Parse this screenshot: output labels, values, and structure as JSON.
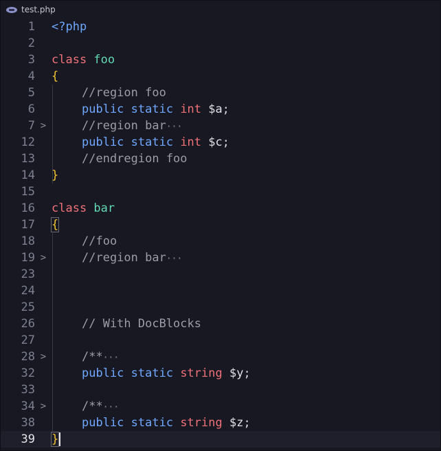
{
  "tab": {
    "filename": "test.php",
    "icon": "php-file-icon"
  },
  "colors": {
    "background": "#181822",
    "keyword_red": "#f07178",
    "keyword_blue": "#6fa8ff",
    "class_name": "#62d8b4",
    "brace": "#f0c431",
    "comment": "#9a9ca8",
    "line_number": "#7d8090"
  },
  "lines": [
    {
      "num": "1",
      "fold": "",
      "indent": false,
      "tokens": [
        {
          "t": "<?php",
          "c": "kw-blue"
        }
      ]
    },
    {
      "num": "2",
      "fold": "",
      "indent": false,
      "tokens": []
    },
    {
      "num": "3",
      "fold": "",
      "indent": false,
      "tokens": [
        {
          "t": "class ",
          "c": "kw-red"
        },
        {
          "t": "foo",
          "c": "ident-green"
        }
      ]
    },
    {
      "num": "4",
      "fold": "",
      "indent": false,
      "tokens": [
        {
          "t": "{",
          "c": "brace"
        }
      ]
    },
    {
      "num": "5",
      "fold": "",
      "indent": true,
      "tokens": [
        {
          "t": "//region foo",
          "c": "comment"
        }
      ]
    },
    {
      "num": "6",
      "fold": "",
      "indent": true,
      "tokens": [
        {
          "t": "public ",
          "c": "kw-blue"
        },
        {
          "t": "static ",
          "c": "kw-blue"
        },
        {
          "t": "int ",
          "c": "kw-red"
        },
        {
          "t": "$a",
          "c": "var"
        },
        {
          "t": ";",
          "c": "punct"
        }
      ]
    },
    {
      "num": "7",
      "fold": ">",
      "indent": true,
      "tokens": [
        {
          "t": "//region bar",
          "c": "comment"
        },
        {
          "t": "···",
          "c": "ellipsis"
        }
      ]
    },
    {
      "num": "12",
      "fold": "",
      "indent": true,
      "tokens": [
        {
          "t": "public ",
          "c": "kw-blue"
        },
        {
          "t": "static ",
          "c": "kw-blue"
        },
        {
          "t": "int ",
          "c": "kw-red"
        },
        {
          "t": "$c",
          "c": "var"
        },
        {
          "t": ";",
          "c": "punct"
        }
      ]
    },
    {
      "num": "13",
      "fold": "",
      "indent": true,
      "tokens": [
        {
          "t": "//endregion foo",
          "c": "comment"
        }
      ]
    },
    {
      "num": "14",
      "fold": "",
      "indent": false,
      "tokens": [
        {
          "t": "}",
          "c": "brace"
        }
      ]
    },
    {
      "num": "15",
      "fold": "",
      "indent": false,
      "tokens": []
    },
    {
      "num": "16",
      "fold": "",
      "indent": false,
      "tokens": [
        {
          "t": "class ",
          "c": "kw-red"
        },
        {
          "t": "bar",
          "c": "ident-green"
        }
      ]
    },
    {
      "num": "17",
      "fold": "",
      "indent": false,
      "tokens": [
        {
          "t": "{",
          "c": "brace",
          "boxed": true
        }
      ]
    },
    {
      "num": "18",
      "fold": "",
      "indent": true,
      "tokens": [
        {
          "t": "//foo",
          "c": "comment"
        }
      ]
    },
    {
      "num": "19",
      "fold": ">",
      "indent": true,
      "tokens": [
        {
          "t": "//region bar",
          "c": "comment"
        },
        {
          "t": "···",
          "c": "ellipsis"
        }
      ]
    },
    {
      "num": "23",
      "fold": "",
      "indent": false,
      "tokens": []
    },
    {
      "num": "24",
      "fold": "",
      "indent": false,
      "tokens": []
    },
    {
      "num": "25",
      "fold": "",
      "indent": false,
      "tokens": []
    },
    {
      "num": "26",
      "fold": "",
      "indent": true,
      "tokens": [
        {
          "t": "// With DocBlocks",
          "c": "comment"
        }
      ]
    },
    {
      "num": "27",
      "fold": "",
      "indent": false,
      "tokens": []
    },
    {
      "num": "28",
      "fold": ">",
      "indent": true,
      "tokens": [
        {
          "t": "/**",
          "c": "comment"
        },
        {
          "t": "···",
          "c": "ellipsis"
        }
      ]
    },
    {
      "num": "32",
      "fold": "",
      "indent": true,
      "tokens": [
        {
          "t": "public ",
          "c": "kw-blue"
        },
        {
          "t": "static ",
          "c": "kw-blue"
        },
        {
          "t": "string ",
          "c": "kw-red"
        },
        {
          "t": "$y",
          "c": "var"
        },
        {
          "t": ";",
          "c": "punct"
        }
      ]
    },
    {
      "num": "33",
      "fold": "",
      "indent": false,
      "tokens": []
    },
    {
      "num": "34",
      "fold": ">",
      "indent": true,
      "tokens": [
        {
          "t": "/**",
          "c": "comment"
        },
        {
          "t": "···",
          "c": "ellipsis"
        }
      ]
    },
    {
      "num": "38",
      "fold": "",
      "indent": true,
      "tokens": [
        {
          "t": "public ",
          "c": "kw-blue"
        },
        {
          "t": "static ",
          "c": "kw-blue"
        },
        {
          "t": "string ",
          "c": "kw-red"
        },
        {
          "t": "$z",
          "c": "var"
        },
        {
          "t": ";",
          "c": "punct"
        }
      ]
    },
    {
      "num": "39",
      "fold": "",
      "indent": false,
      "current": true,
      "tokens": [
        {
          "t": "}",
          "c": "brace",
          "boxed": true,
          "cursor": true
        }
      ]
    }
  ]
}
